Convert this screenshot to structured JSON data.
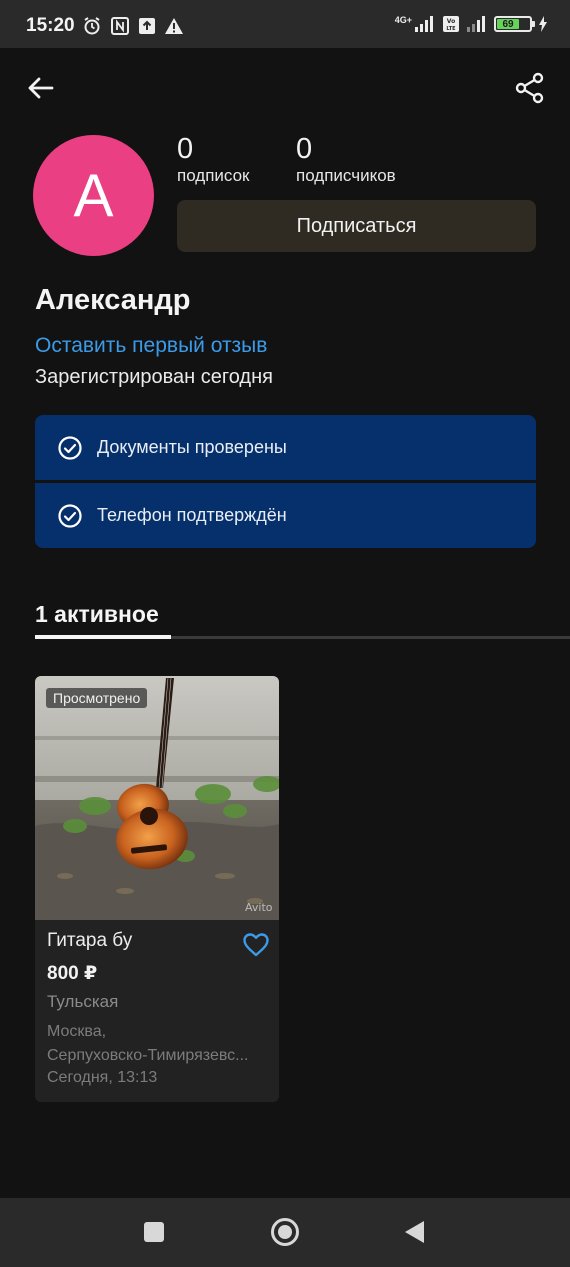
{
  "status_bar": {
    "time": "15:20",
    "network": "4G+",
    "battery": "69"
  },
  "header": {
    "back_icon": "arrow-left-icon",
    "share_icon": "share-icon"
  },
  "profile": {
    "avatar_letter": "A",
    "avatar_color": "#ea3f82",
    "following_count": "0",
    "following_label": "подписок",
    "followers_count": "0",
    "followers_label": "подписчиков",
    "subscribe_label": "Подписаться",
    "name": "Александр",
    "review_link": "Оставить первый отзыв",
    "registered": "Зарегистрирован сегодня"
  },
  "verifications": [
    {
      "label": "Документы проверены",
      "icon": "check-circle-icon"
    },
    {
      "label": "Телефон подтверждён",
      "icon": "check-circle-icon"
    }
  ],
  "tabs": {
    "active_label": "1 активное"
  },
  "listing": {
    "badge": "Просмотрено",
    "title": "Гитара бу",
    "price": "800 ₽",
    "location": "Тульская",
    "address_line1": "Москва,",
    "address_line2": "Серпуховско-Тимирязевс...",
    "time": "Сегодня, 13:13",
    "watermark": "Avito"
  },
  "colors": {
    "accent_link": "#3b9be8",
    "verify_bg": "#06306b",
    "background": "#121212"
  }
}
